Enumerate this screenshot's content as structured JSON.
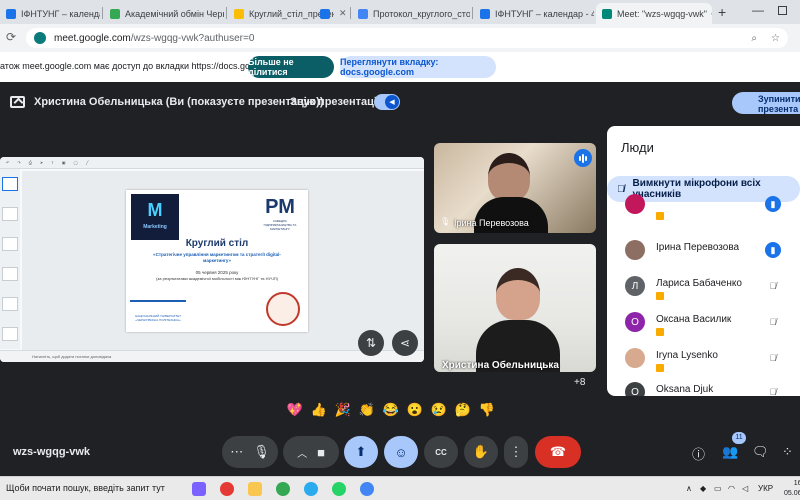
{
  "browser": {
    "tabs": [
      {
        "label": "ІФНТУНГ – календар - 4 д",
        "fav_color": "#1a73e8",
        "active": false
      },
      {
        "label": "Академічний обмін Черн",
        "fav_color": "#34a853",
        "active": false
      },
      {
        "label": "Круглий_стіл_презент",
        "fav_color": "#fbbc04",
        "active": false
      },
      {
        "label": "",
        "fav_color": "#1a73e8",
        "active": false
      },
      {
        "label": "Протокол_круглого_стол",
        "fav_color": "#4285f4",
        "active": false
      },
      {
        "label": "ІФНТУНГ – календар - 4 д",
        "fav_color": "#1a73e8",
        "active": false
      },
      {
        "label": "Meet: \"wzs-wgqg-vwk\"",
        "fav_color": "#00897b",
        "active": true
      }
    ],
    "new_tab": "+",
    "url_host": "meet.google.com",
    "url_path": "/wzs-wgqg-vwk?authuser=0"
  },
  "sharebar": {
    "message": "атож meet.google.com має доступ до вкладки https://docs.google.com",
    "stop_label": "Більше не ділитися",
    "switch_label": "Переглянути вкладку: docs.google.com"
  },
  "meet": {
    "presenter_text": "Христина Обельницька (Ви (показуєте презентацію))",
    "sound_label": "Звук презентації",
    "stop_presenting_label": "Зупинити презента",
    "meeting_code": "wzs-wgqg-vwk",
    "more_participants": "+8",
    "people_count": "11"
  },
  "slide": {
    "logo_letter": "M",
    "logo_caption": "Marketing",
    "rm_letters": "РМ",
    "rm_caption": "КАФЕДРА ПІДПРИЄМНИЦТВА ТА МАРКЕТИНГУ",
    "title": "Круглий стіл",
    "subtitle": "«Стратегічне управління маркетингом та стратегії digital-маркетингу»",
    "date": "05 червня 2025 року",
    "note": "(за результатами академічної мобільності між ІФНТУНГ та НУЧП)",
    "univ_caption": "НАЦІОНАЛЬНИЙ УНІВЕРСИТЕТ «ЧЕРНІГІВСЬКА ПОЛІТЕХНІКА»",
    "statusbar": "Натисніть, щоб додати нотатки доповідача"
  },
  "tiles": [
    {
      "name": "Ірина Перевозова"
    },
    {
      "name": "Христина Обельницька"
    }
  ],
  "people_panel": {
    "title": "Люди",
    "mute_all": "Вимкнути мікрофони всіх учасників",
    "rows": [
      {
        "name": "",
        "initial": "",
        "avatar_color": "#c2185b",
        "mic": "on"
      },
      {
        "name": "Ірина Перевозова",
        "initial": "",
        "avatar_color": "#8d6e63",
        "mic": "on"
      },
      {
        "name": "Лариса Бабаченко",
        "initial": "Л",
        "avatar_color": "#5f6368",
        "mic": "off"
      },
      {
        "name": "Оксана Василик",
        "initial": "О",
        "avatar_color": "#8e24aa",
        "mic": "off"
      },
      {
        "name": "Iryna Lysenko",
        "initial": "",
        "avatar_color": "#d7a98f",
        "mic": "off"
      },
      {
        "name": "Oksana Djuk",
        "initial": "O",
        "avatar_color": "#3c4043",
        "mic": "off"
      }
    ]
  },
  "reactions": [
    "💖",
    "👍",
    "🎉",
    "👏",
    "😂",
    "😮",
    "😢",
    "🤔",
    "👎"
  ],
  "taskbar": {
    "search": "Щоби почати пошук, введіть запит тут",
    "lang": "УКР",
    "time": "16:0",
    "date": "05.06.2"
  }
}
